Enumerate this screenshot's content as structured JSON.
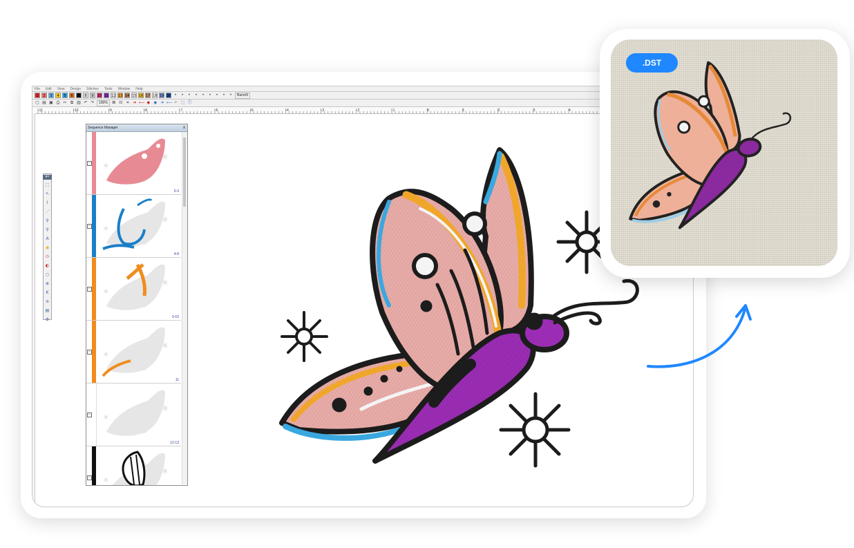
{
  "app": {
    "menu": [
      "File",
      "Edit",
      "View",
      "Design",
      "Stitches",
      "Tools",
      "Window",
      "Help"
    ],
    "color_swatches": [
      {
        "label": "1",
        "color": "#e8262b"
      },
      {
        "label": "2",
        "color": "#f07070"
      },
      {
        "label": "3",
        "color": "#5aaae8"
      },
      {
        "label": "4",
        "color": "#f4d020"
      },
      {
        "label": "5",
        "color": "#22a0e0"
      },
      {
        "label": "6",
        "color": "#e07020"
      },
      {
        "label": "7",
        "color": "#111111"
      },
      {
        "label": "8",
        "color": "#e8e8e8"
      },
      {
        "label": "9",
        "color": "#d0d0d0"
      },
      {
        "label": "10",
        "color": "#e03080"
      },
      {
        "label": "11",
        "color": "#8030c0"
      },
      {
        "label": "12",
        "color": "#f0f0f0"
      },
      {
        "label": "13",
        "color": "#f0a030"
      },
      {
        "label": "14",
        "color": "#c08050"
      },
      {
        "label": "15",
        "color": "#f4f4f4"
      },
      {
        "label": "16",
        "color": "#ffc020"
      },
      {
        "label": "17",
        "color": "#c09060"
      },
      {
        "label": "18",
        "color": "#ffffff"
      },
      {
        "label": "19",
        "color": "#7090d0"
      },
      {
        "label": "20",
        "color": "#1050a0"
      }
    ],
    "font_select": "Baron5",
    "zoom": "100%",
    "ruler_labels": [
      "-11",
      "-10",
      "-9",
      "-8",
      "-7",
      "-6",
      "-5",
      "-4",
      "-3",
      "-2",
      "-1",
      "0",
      "1",
      "2",
      "3",
      "4"
    ]
  },
  "sequence_manager": {
    "title": "Sequence Manager",
    "close": "x",
    "items": [
      {
        "range": "0-3",
        "color": "#e88a94"
      },
      {
        "range": "4-8",
        "color": "#1a7fc8"
      },
      {
        "range": "9-10",
        "color": "#f08c1c"
      },
      {
        "range": "11",
        "color": "#f08c1c"
      },
      {
        "range": "12-13",
        "color": "#ffffff"
      },
      {
        "range": "",
        "color": "#111111"
      }
    ]
  },
  "preview": {
    "badge": ".DST"
  },
  "colors": {
    "pink": "#e8b0ac",
    "orange": "#f0a62a",
    "blue": "#3aa8e0",
    "purple": "#9a2fb0",
    "black": "#1c1c1c",
    "accent": "#1f87ff"
  }
}
